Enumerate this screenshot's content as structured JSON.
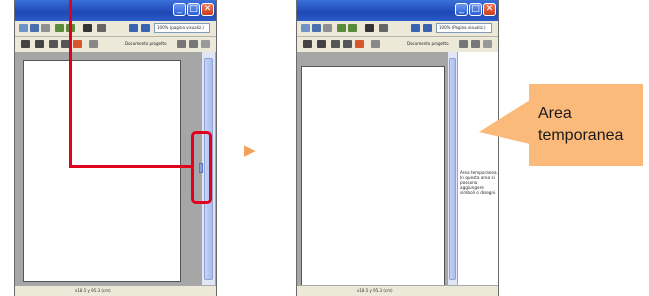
{
  "left_window": {
    "zoom_label": "100% (pagina visualiz.)",
    "toolbar_label": "Documento progetto",
    "status_text": "x18.5 y 95.3 (cm)"
  },
  "right_window": {
    "zoom_label": "100% (Pagina visualiz.)",
    "toolbar_label": "Documento progetto",
    "status_text": "x18.5 y 95.3 (cm)",
    "temp_area_text": "Area temporanea. In questa area si possono aggiungere simboli o disegni."
  },
  "callout": {
    "label": "Area\ntemporanea"
  },
  "arrow": {
    "symbol": "▶"
  },
  "colors": {
    "highlight": "#e1001e",
    "callout": "#fbb97a",
    "arrow": "#f4a05a",
    "titlebar": "#2a5cc9"
  }
}
